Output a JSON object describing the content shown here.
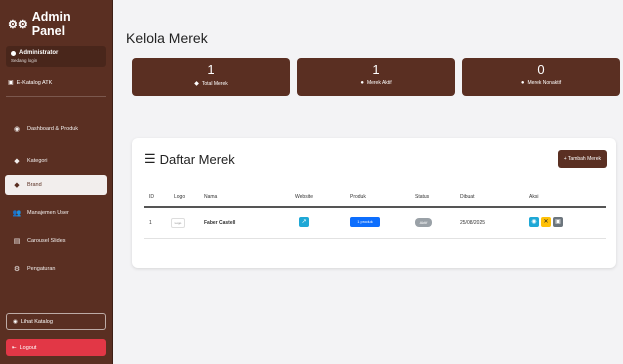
{
  "sidebar": {
    "title": "Admin Panel",
    "user_role": "Administrator",
    "user_status": "Sedang login",
    "site_link": "E-Katalog ATK",
    "items": [
      {
        "label": "Dashboard & Produk"
      },
      {
        "label": "Kategori"
      },
      {
        "label": "Brand"
      },
      {
        "label": "Manajemen User"
      },
      {
        "label": "Carousel Slides"
      },
      {
        "label": "Pengaturan"
      }
    ],
    "katalog_button": "Lihat Katalog",
    "logout_button": "Logout"
  },
  "page": {
    "title": "Kelola Merek"
  },
  "stats": [
    {
      "value": "1",
      "label": "Total Merek"
    },
    {
      "value": "1",
      "label": "Merek Aktif"
    },
    {
      "value": "0",
      "label": "Merek Nonaktif"
    }
  ],
  "table_card": {
    "title": "Daftar Merek",
    "add_button": "+ Tambah Merek",
    "headers": [
      "ID",
      "Logo",
      "Nama",
      "Website",
      "Produk",
      "Status",
      "Dibuat",
      "Aksi"
    ],
    "rows": [
      {
        "id": "1",
        "logo": "Logo",
        "name": "Faber Castell",
        "product": "1 produk",
        "status": "Aktif",
        "created": "25/08/2025"
      }
    ]
  },
  "colors": {
    "primary": "#5a2f22",
    "logout": "#e23746",
    "info": "#1fa8d6",
    "warning": "#ffc107"
  }
}
